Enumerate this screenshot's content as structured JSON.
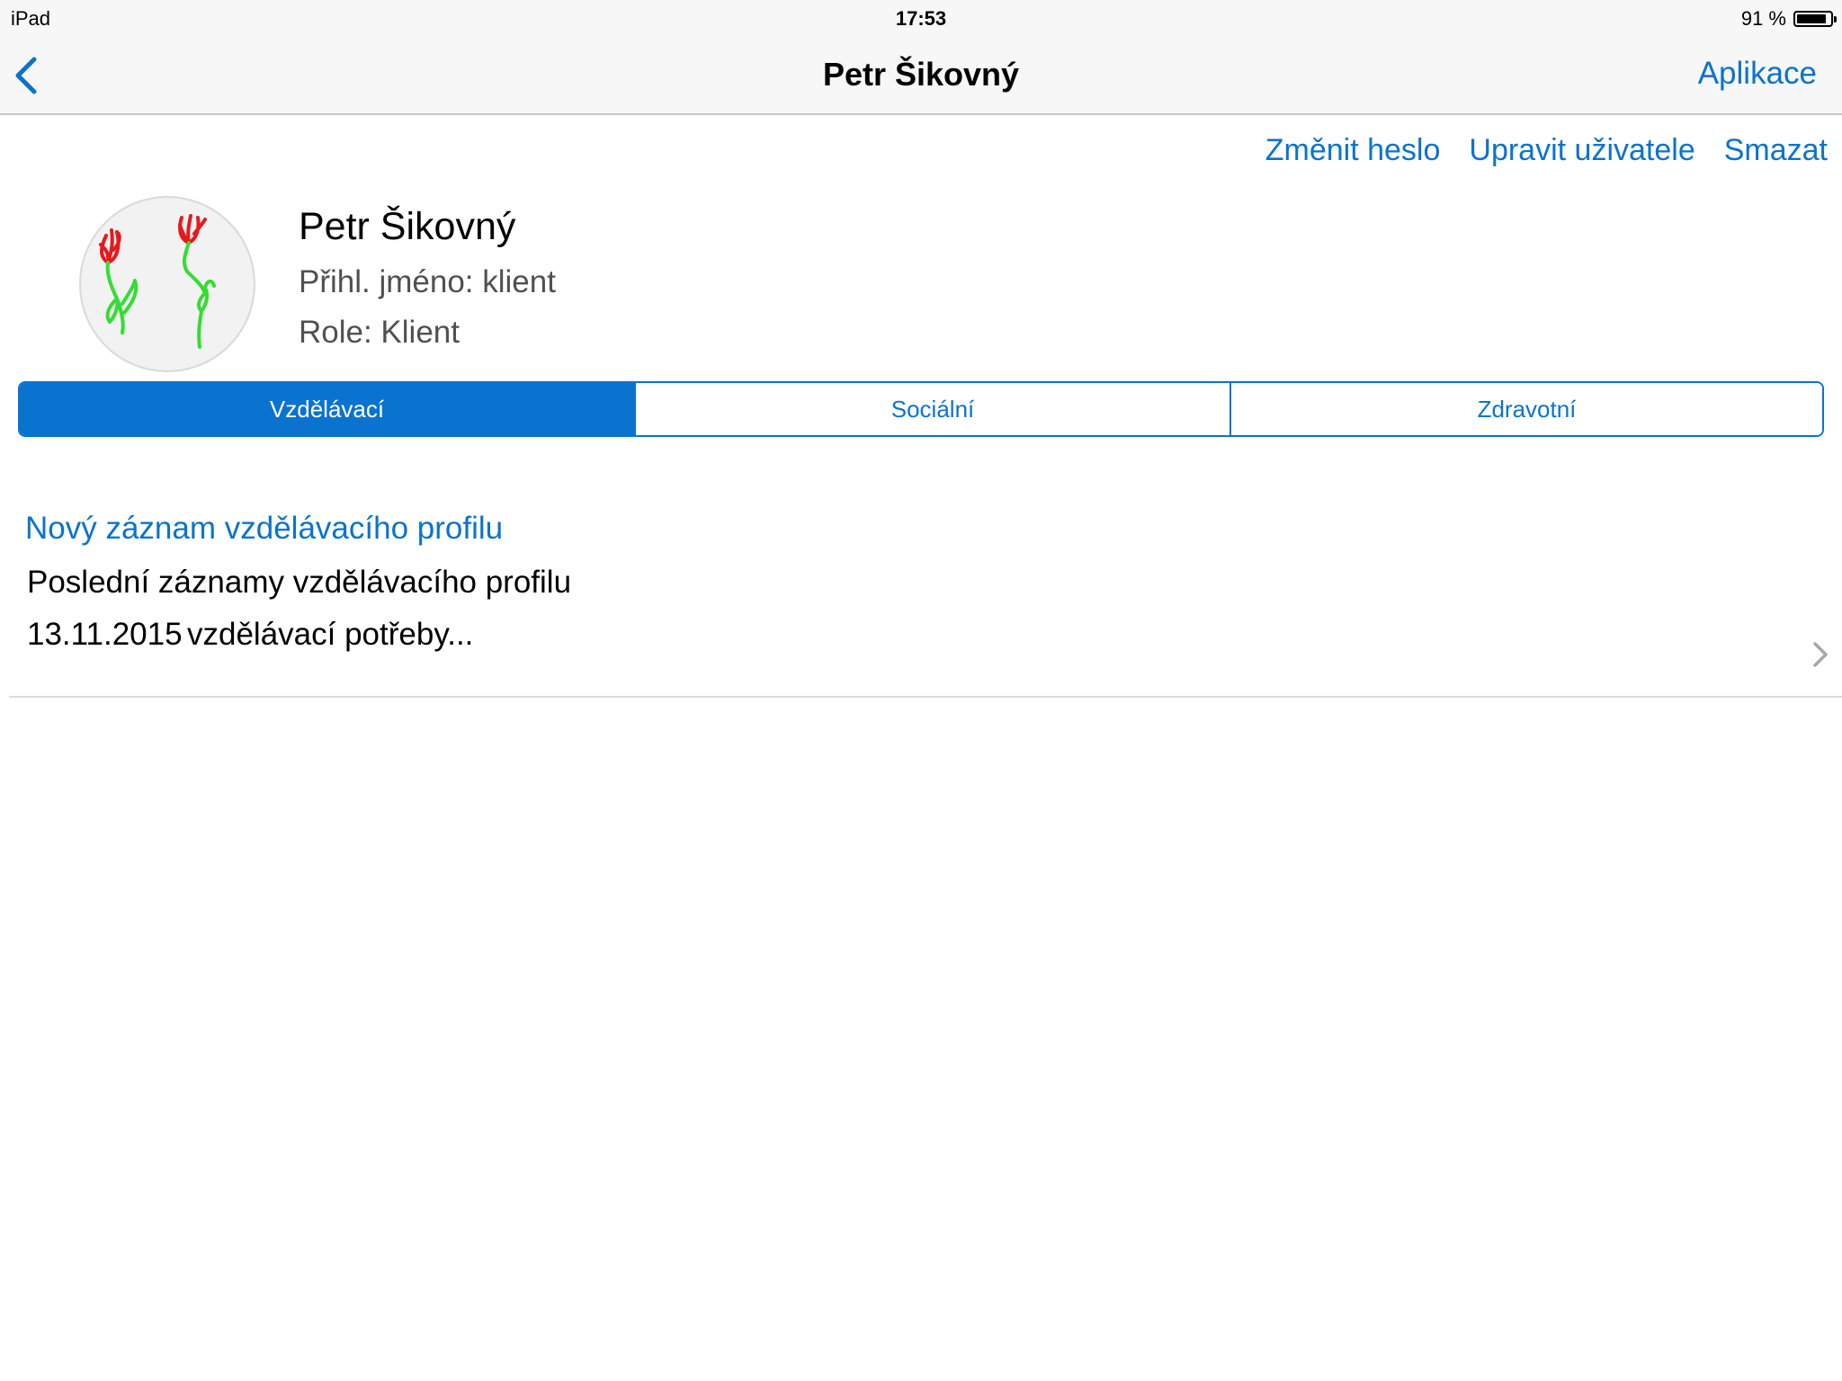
{
  "status_bar": {
    "device": "iPad",
    "time": "17:53",
    "battery_text": "91 %",
    "battery_level": 0.91
  },
  "nav": {
    "back_icon": "chevron-left-icon",
    "title": "Petr Šikovný",
    "right_button": "Aplikace"
  },
  "actions": {
    "change_password": "Změnit heslo",
    "edit_user": "Upravit uživatele",
    "delete": "Smazat"
  },
  "profile": {
    "name": "Petr Šikovný",
    "login": "Přihl. jméno: klient",
    "role": "Role: Klient",
    "avatar_icon": "flowers-drawing-avatar"
  },
  "tabs": [
    {
      "label": "Vzdělávací",
      "selected": true
    },
    {
      "label": "Sociální",
      "selected": false
    },
    {
      "label": "Zdravotní",
      "selected": false
    }
  ],
  "list": {
    "new_record": "Nový záznam vzdělávacího profilu",
    "section_title": "Poslední záznamy vzdělávacího profilu",
    "records": [
      {
        "date": "13.11.2015",
        "description": "vzdělávací potřeby..."
      }
    ]
  },
  "colors": {
    "accent": "#0a73cf",
    "bar_background": "#f7f7f7",
    "secondary_text": "#505050",
    "separator": "#d6dde3"
  }
}
